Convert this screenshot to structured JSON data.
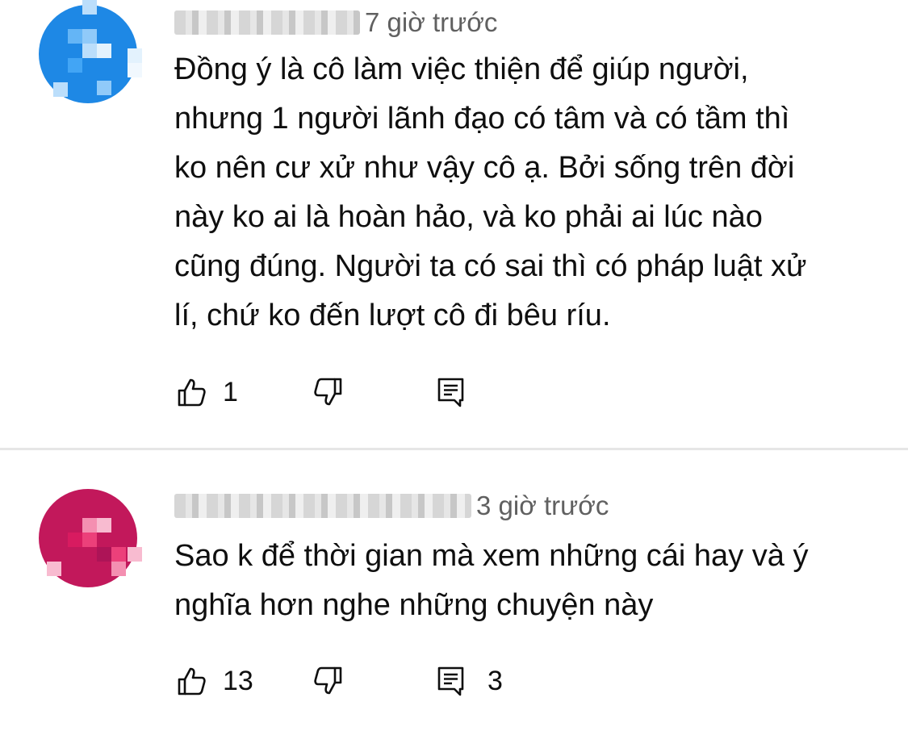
{
  "comments": [
    {
      "time": "7 giờ trước",
      "avatar_color": "#1e88e5",
      "text_lines": [
        "Đồng ý là cô làm việc thiện để giúp người,",
        "nhưng 1 người lãnh đạo có tâm và có tầm thì",
        "ko nên cư xử như vậy cô ạ. Bởi sống trên đời",
        "này ko ai là hoàn hảo, và ko phải ai lúc nào",
        "cũng đúng. Người ta có sai thì có pháp luật xử",
        "lí, chứ ko đến lượt cô đi bêu ríu."
      ],
      "like_count": "1",
      "reply_count": ""
    },
    {
      "time": "3 giờ trước",
      "avatar_color": "#c2185b",
      "text_lines": [
        "Sao k để thời gian mà xem những cái hay và ý",
        "nghĩa hơn nghe những chuyện này"
      ],
      "like_count": "13",
      "reply_count": "3"
    }
  ],
  "icons": {
    "like": "thumbs-up-icon",
    "dislike": "thumbs-down-icon",
    "reply": "reply-comment-icon"
  }
}
